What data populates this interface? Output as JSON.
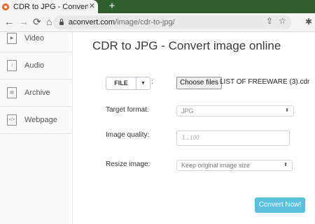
{
  "browser": {
    "tab_title": "CDR to JPG - Convert image online",
    "tab_close": "✕",
    "new_tab": "+",
    "url_domain": "aconvert.com",
    "url_path": "/image/cdr-to-jpg/"
  },
  "sidebar": {
    "items": [
      {
        "label": "Video",
        "icon": "video-file-icon"
      },
      {
        "label": "Audio",
        "icon": "audio-file-icon"
      },
      {
        "label": "Archive",
        "icon": "archive-file-icon"
      },
      {
        "label": "Webpage",
        "icon": "webpage-file-icon"
      }
    ]
  },
  "main": {
    "title": "CDR to JPG - Convert image online",
    "file_button": "FILE",
    "file_colon": ":",
    "choose_files_label": "Choose files",
    "chosen_file": "LIST OF FREEWARE (3).cdr",
    "target_format_label": "Target format:",
    "target_format_value": "JPG",
    "quality_label": "Image quality:",
    "quality_placeholder": "1...100",
    "resize_label": "Resize image:",
    "resize_value": "Keep original image size",
    "convert_button": "Convert Now!"
  },
  "colors": {
    "tabstrip": "#2e5e2c",
    "accent_button": "#5bc0de"
  }
}
